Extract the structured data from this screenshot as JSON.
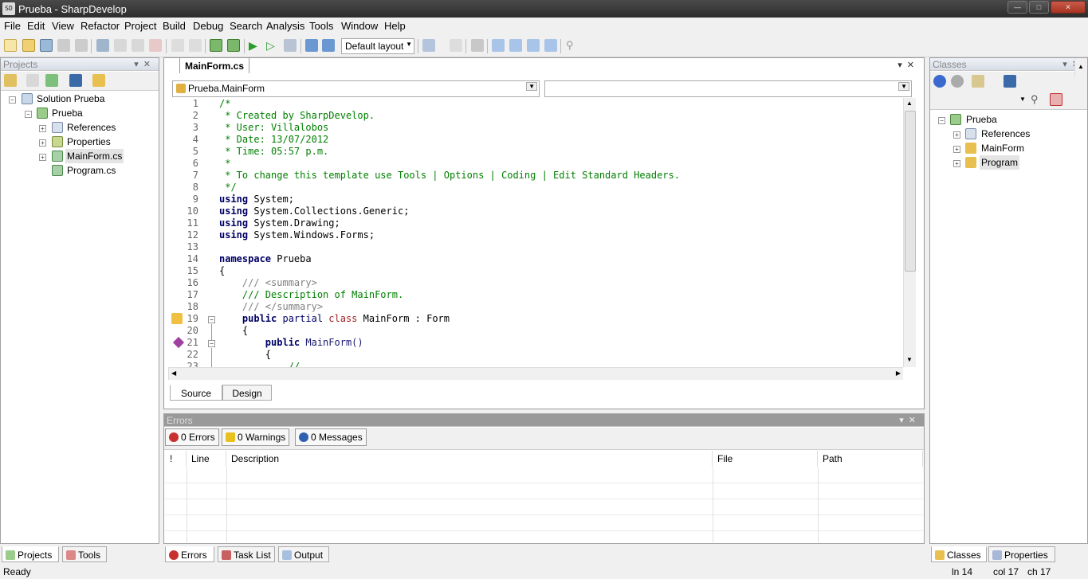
{
  "window": {
    "title": "Prueba - SharpDevelop",
    "app_icon": "SD",
    "min_label": "—",
    "max_label": "□",
    "close_label": "✕"
  },
  "menu": [
    "File",
    "Edit",
    "View",
    "Refactor",
    "Project",
    "Build",
    "Debug",
    "Search",
    "Analysis",
    "Tools",
    "Window",
    "Help"
  ],
  "toolbar": {
    "layout_combo": "Default layout"
  },
  "projects": {
    "title": "Projects",
    "solution": "Solution Prueba",
    "project": "Prueba",
    "items": [
      "References",
      "Properties",
      "MainForm.cs",
      "Program.cs"
    ]
  },
  "editor": {
    "tab": "MainForm.cs",
    "class_combo": "Prueba.MainForm",
    "member_combo": "",
    "tabs": [
      "Source",
      "Design"
    ],
    "lines": [
      {
        "n": "1",
        "t": "/*"
      },
      {
        "n": "2",
        "t": " * Created by SharpDevelop."
      },
      {
        "n": "3",
        "t": " * User: Villalobos"
      },
      {
        "n": "4",
        "t": " * Date: 13/07/2012"
      },
      {
        "n": "5",
        "t": " * Time: 05:57 p.m."
      },
      {
        "n": "6",
        "t": " *"
      },
      {
        "n": "7",
        "t": " * To change this template use Tools | Options | Coding | Edit Standard Headers."
      },
      {
        "n": "8",
        "t": " */"
      },
      {
        "n": "9",
        "kw": "using",
        "t": " System;"
      },
      {
        "n": "10",
        "kw": "using",
        "t": " System.Collections.Generic;"
      },
      {
        "n": "11",
        "kw": "using",
        "t": " System.Drawing;"
      },
      {
        "n": "12",
        "kw": "using",
        "t": " System.Windows.Forms;"
      },
      {
        "n": "13",
        "t": ""
      },
      {
        "n": "14",
        "kw": "namespace",
        "t": " Prueba"
      },
      {
        "n": "15",
        "t": "{"
      },
      {
        "n": "16",
        "doc": "    /// <summary>"
      },
      {
        "n": "17",
        "cmt": "    /// Description of MainForm."
      },
      {
        "n": "18",
        "doc": "    /// </summary>"
      },
      {
        "n": "19",
        "pub": "    public",
        "mid": " partial ",
        "cls": "class",
        "t": " MainForm : Form"
      },
      {
        "n": "20",
        "t": "    {"
      },
      {
        "n": "21",
        "pub": "        public",
        "t": " MainForm()"
      },
      {
        "n": "22",
        "t": "        {"
      },
      {
        "n": "23",
        "t": "            //"
      }
    ]
  },
  "errors": {
    "title": "Errors",
    "errors_btn": "0 Errors",
    "warnings_btn": "0 Warnings",
    "messages_btn": "0 Messages",
    "columns": [
      "!",
      "Line",
      "Description",
      "File",
      "Path"
    ]
  },
  "bottom_tabs": [
    "Errors",
    "Task List",
    "Output"
  ],
  "left_tabs": [
    "Projects",
    "Tools"
  ],
  "classes": {
    "title": "Classes",
    "root": "Prueba",
    "items": [
      "References",
      "MainForm",
      "Program"
    ]
  },
  "right_tabs": [
    "Classes",
    "Properties"
  ],
  "status": {
    "left": "Ready",
    "ln": "ln 14",
    "col": "col 17",
    "ch": "ch 17"
  }
}
